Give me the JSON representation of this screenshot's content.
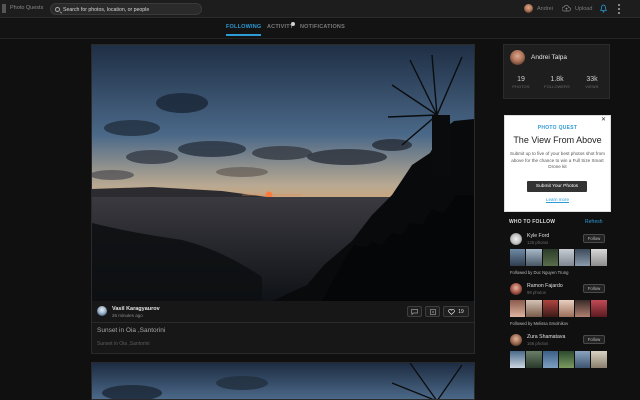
{
  "app": {
    "name": "Photo Quests"
  },
  "search": {
    "placeholder": "Search for photos, location, or people"
  },
  "user": {
    "name": "Andrei",
    "upload_label": "Upload"
  },
  "tabs": [
    {
      "label": "FOLLOWING",
      "active": true
    },
    {
      "label": "ACTIVITY",
      "active": false
    },
    {
      "label": "NOTIFICATIONS",
      "active": false
    }
  ],
  "post": {
    "author": "Vasil Karagyaurov",
    "time": "26 minutes ago",
    "likes": "19",
    "title": "Sunset in Oia ,Santorini",
    "location": "Sunset in Oia ,Santorini"
  },
  "profile": {
    "name": "Andrei Talpa",
    "stats": [
      {
        "value": "19",
        "label": "PHOTOS"
      },
      {
        "value": "1.8k",
        "label": "FOLLOWERS"
      },
      {
        "value": "33k",
        "label": "VIEWS"
      }
    ]
  },
  "ad": {
    "brand": "PHOTO QUEST",
    "title": "The View From Above",
    "text": "Submit up to five of your best photos shot from above for the chance to win a Full Size Smart Drone kit",
    "button": "Submit Your Photos",
    "link": "Learn more"
  },
  "who_to_follow": {
    "title": "WHO TO FOLLOW",
    "refresh": "Refresh",
    "users": [
      {
        "name": "Kyle Ford",
        "count": "125 photos",
        "follow": "Follow",
        "followed_by": "Followed by Duc Nguyen Trung"
      },
      {
        "name": "Ramon Fajardo",
        "count": "99 photos",
        "follow": "Follow",
        "followed_by": "Followed by Melissa Smolnikov"
      },
      {
        "name": "Zura Shamatava",
        "count": "166 photos",
        "follow": "Follow"
      }
    ]
  },
  "colors": {
    "accent": "#2d9bd6",
    "background": "#101010"
  }
}
